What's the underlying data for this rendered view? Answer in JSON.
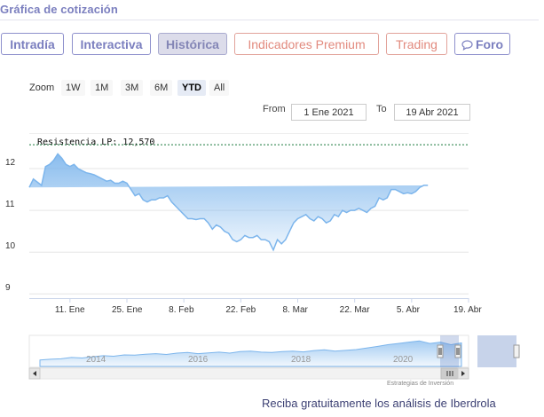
{
  "section": {
    "title": "Gráfica de cotización"
  },
  "tabs": [
    {
      "label": "Intradía"
    },
    {
      "label": "Interactiva"
    },
    {
      "label": "Histórica"
    },
    {
      "label": "Indicadores Premium"
    },
    {
      "label": "Trading"
    },
    {
      "label": "Foro"
    }
  ],
  "zoom": {
    "label": "Zoom",
    "options": [
      "1W",
      "1M",
      "3M",
      "6M",
      "YTD",
      "All"
    ],
    "selected": "YTD"
  },
  "range": {
    "from_label": "From",
    "from_value": "1 Ene 2021",
    "to_label": "To",
    "to_value": "19 Abr 2021"
  },
  "colors": {
    "accent": "#7b7fbf",
    "premium": "#e28a7e",
    "series_line": "#7cb5ec",
    "resistance": "#1a7a3c"
  },
  "chart_data": {
    "type": "area",
    "annotations": [
      {
        "label": "Resistencia LP: 12,570",
        "value": 12.57
      }
    ],
    "ylim": [
      8.9,
      12.85
    ],
    "yticks": [
      9,
      10,
      11,
      12
    ],
    "xlim": [
      0,
      108
    ],
    "xticks": [
      {
        "label": "11. Ene",
        "x": 10
      },
      {
        "label": "25. Ene",
        "x": 24
      },
      {
        "label": "8. Feb",
        "x": 38
      },
      {
        "label": "22. Feb",
        "x": 52
      },
      {
        "label": "8. Mar",
        "x": 66
      },
      {
        "label": "22. Mar",
        "x": 80
      },
      {
        "label": "5. Abr",
        "x": 94
      },
      {
        "label": "19. Abr",
        "x": 108
      }
    ],
    "x": [
      0,
      1,
      3,
      4,
      5,
      6,
      7,
      8,
      9,
      10,
      11,
      12,
      13,
      14,
      15,
      16,
      17,
      18,
      19,
      20,
      21,
      22,
      23,
      24,
      25,
      26,
      27,
      28,
      29,
      30,
      31,
      32,
      33,
      34,
      35,
      36,
      37,
      38,
      39,
      40,
      41,
      42,
      43,
      44,
      45,
      46,
      47,
      48,
      49,
      50,
      51,
      52,
      53,
      54,
      55,
      56,
      57,
      58,
      59,
      60,
      61,
      62,
      63,
      64,
      65,
      66,
      67,
      68,
      69,
      70,
      71,
      72,
      73,
      74,
      75,
      76,
      77,
      78,
      79,
      80,
      81,
      82,
      83,
      84,
      85,
      86,
      87,
      88,
      89,
      90,
      91,
      92,
      93,
      94,
      95,
      96,
      97,
      98,
      99,
      100,
      101,
      102,
      103,
      104,
      105,
      106,
      107,
      108
    ],
    "values": [
      11.55,
      11.75,
      11.6,
      12.05,
      12.1,
      12.2,
      12.35,
      12.25,
      12.1,
      12.05,
      12.1,
      12.0,
      11.95,
      11.9,
      11.88,
      11.85,
      11.8,
      11.75,
      11.7,
      11.72,
      11.65,
      11.65,
      11.7,
      11.65,
      11.5,
      11.35,
      11.4,
      11.25,
      11.2,
      11.25,
      11.25,
      11.3,
      11.3,
      11.35,
      11.2,
      11.1,
      11.0,
      10.9,
      10.8,
      10.8,
      10.78,
      10.8,
      10.8,
      10.7,
      10.55,
      10.65,
      10.6,
      10.5,
      10.45,
      10.3,
      10.25,
      10.3,
      10.4,
      10.35,
      10.35,
      10.4,
      10.3,
      10.3,
      10.25,
      10.05,
      10.3,
      10.2,
      10.3,
      10.5,
      10.7,
      10.8,
      10.85,
      10.9,
      10.8,
      10.75,
      10.85,
      10.8,
      10.7,
      10.75,
      10.9,
      10.85,
      11.0,
      10.95,
      11.0,
      11.0,
      11.05,
      11.0,
      10.95,
      11.05,
      11.1,
      11.3,
      11.25,
      11.3,
      11.5,
      11.5,
      11.45,
      11.4,
      11.42,
      11.4,
      11.45,
      11.55,
      11.6,
      11.6
    ],
    "navigator": {
      "labels": [
        "2014",
        "2016",
        "2018",
        "2020"
      ],
      "values": [
        0.25,
        0.28,
        0.3,
        0.35,
        0.33,
        0.38,
        0.42,
        0.4,
        0.45,
        0.44,
        0.48,
        0.5,
        0.47,
        0.52,
        0.55,
        0.5,
        0.53,
        0.56,
        0.52,
        0.58,
        0.6,
        0.56,
        0.55,
        0.58,
        0.6,
        0.57,
        0.62,
        0.65,
        0.6,
        0.63,
        0.66,
        0.72,
        0.78,
        0.85,
        0.9,
        0.95,
        1.0,
        0.9,
        0.95,
        0.85,
        0.92
      ]
    }
  },
  "credits": "Estrategias de Inversión",
  "promo": "Reciba gratuitamente los análisis de Iberdrola"
}
